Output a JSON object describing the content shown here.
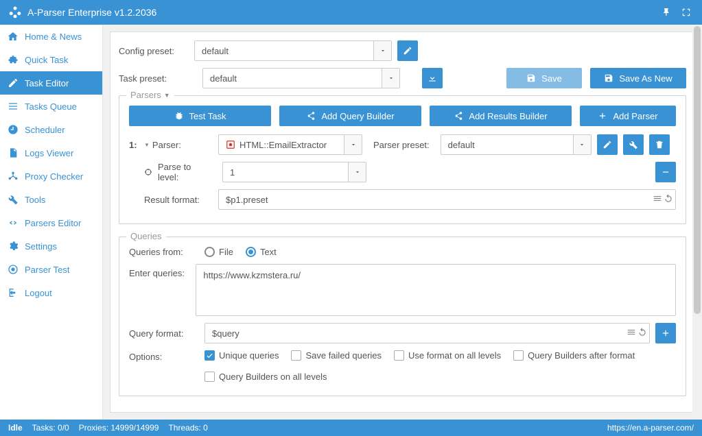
{
  "app": {
    "title": "A-Parser Enterprise v1.2.2036"
  },
  "sidebar": {
    "items": [
      {
        "label": "Home & News",
        "icon": "home"
      },
      {
        "label": "Quick Task",
        "icon": "puzzle"
      },
      {
        "label": "Task Editor",
        "icon": "pencil"
      },
      {
        "label": "Tasks Queue",
        "icon": "list"
      },
      {
        "label": "Scheduler",
        "icon": "clock"
      },
      {
        "label": "Logs Viewer",
        "icon": "file"
      },
      {
        "label": "Proxy Checker",
        "icon": "network"
      },
      {
        "label": "Tools",
        "icon": "wrench"
      },
      {
        "label": "Parsers Editor",
        "icon": "code"
      },
      {
        "label": "Settings",
        "icon": "gear"
      },
      {
        "label": "Parser Test",
        "icon": "target"
      },
      {
        "label": "Logout",
        "icon": "logout"
      }
    ]
  },
  "form": {
    "config_preset_label": "Config preset:",
    "config_preset_value": "default",
    "task_preset_label": "Task preset:",
    "task_preset_value": "default",
    "save_label": "Save",
    "save_as_new_label": "Save As New"
  },
  "parsers": {
    "legend": "Parsers",
    "test_task": "Test Task",
    "add_query_builder": "Add Query Builder",
    "add_results_builder": "Add Results Builder",
    "add_parser": "Add Parser",
    "row": {
      "num": "1:",
      "parser_label": "Parser:",
      "parser_value": "HTML::EmailExtractor",
      "parser_preset_label": "Parser preset:",
      "parser_preset_value": "default",
      "parse_to_level_label": "Parse to level:",
      "parse_to_level_value": "1",
      "result_format_label": "Result format:",
      "result_format_value": "$p1.preset"
    }
  },
  "queries": {
    "legend": "Queries",
    "queries_from_label": "Queries from:",
    "radio_file": "File",
    "radio_text": "Text",
    "enter_queries_label": "Enter queries:",
    "enter_queries_value": "https://www.kzmstera.ru/",
    "query_format_label": "Query format:",
    "query_format_value": "$query",
    "options_label": "Options:",
    "opts": {
      "unique": "Unique queries",
      "save_failed": "Save failed queries",
      "use_format_all": "Use format on all levels",
      "qb_after_format": "Query Builders after format",
      "qb_all_levels": "Query Builders on all levels"
    }
  },
  "status": {
    "idle": "Idle",
    "tasks": "Tasks: 0/0",
    "proxies": "Proxies: 14999/14999",
    "threads": "Threads: 0",
    "link": "https://en.a-parser.com/"
  }
}
